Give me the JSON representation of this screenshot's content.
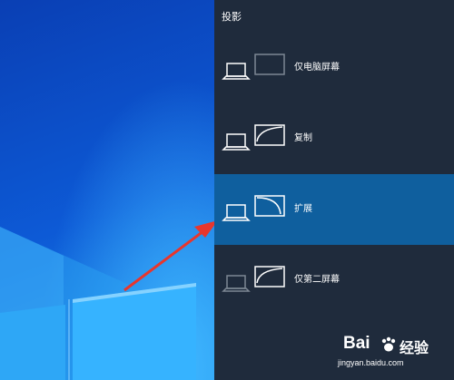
{
  "panel": {
    "title": "投影",
    "options": [
      {
        "label": "仅电脑屏幕",
        "selected": false,
        "icon": "pc-screen-only-icon"
      },
      {
        "label": "复制",
        "selected": false,
        "icon": "duplicate-icon"
      },
      {
        "label": "扩展",
        "selected": true,
        "icon": "extend-icon"
      },
      {
        "label": "仅第二屏幕",
        "selected": false,
        "icon": "second-screen-only-icon"
      }
    ]
  },
  "watermark": {
    "logo": "Bai",
    "text": "经验",
    "url": "jingyan.baidu.com"
  },
  "colors": {
    "panel_bg": "#1f2b3c",
    "selected_bg": "#0f5f9e",
    "arrow": "#e8362d"
  }
}
